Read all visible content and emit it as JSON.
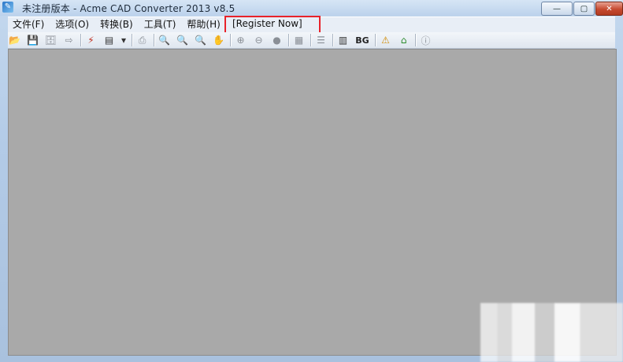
{
  "window": {
    "title": "未注册版本 - Acme CAD Converter 2013 v8.5",
    "controls": {
      "minimize": "—",
      "maximize": "▢",
      "close": "✕"
    }
  },
  "menu": {
    "items": [
      {
        "label": "文件(F)"
      },
      {
        "label": "选项(O)"
      },
      {
        "label": "转换(B)"
      },
      {
        "label": "工具(T)"
      },
      {
        "label": "帮助(H)"
      }
    ],
    "register": "[Register Now]"
  },
  "toolbar": {
    "bg_label": "BG",
    "icons": [
      "open-icon",
      "save-icon",
      "save-all-icon",
      "export-icon",
      "convert-icon",
      "batch-icon",
      "dropdown-icon",
      "print-icon",
      "zoom-out-icon",
      "zoom-in-icon",
      "zoom-window-icon",
      "pan-icon",
      "zoom-prev-icon",
      "zoom-extents-icon",
      "zoom-realtime-icon",
      "layers-icon",
      "layout-icon",
      "background-icon",
      "warning-icon",
      "home-icon",
      "info-icon"
    ]
  }
}
